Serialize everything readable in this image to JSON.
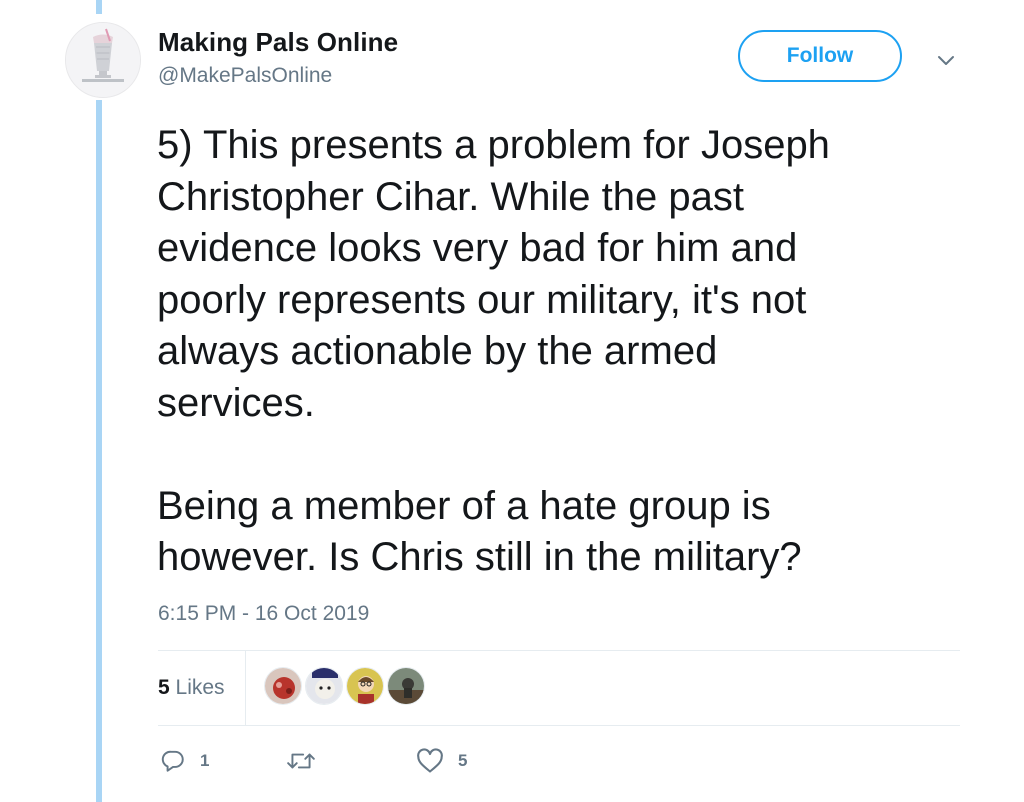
{
  "author": {
    "name": "Making Pals Online",
    "handle": "@MakePalsOnline"
  },
  "follow_label": "Follow",
  "tweet": {
    "text": "5) This presents a problem for Joseph\nChristopher Cihar. While the past\nevidence looks very bad for him and\npoorly represents our military, it's not\nalways actionable by the armed\nservices.\n\nBeing a member of a hate group is\nhowever. Is Chris still in the military?",
    "timestamp": "6:15 PM - 16 Oct 2019"
  },
  "stats": {
    "likes_count": "5",
    "likes_word": "Likes"
  },
  "actions": {
    "reply_count": "1",
    "retweet_count": "",
    "like_count": "5"
  },
  "icons": {
    "reply": "reply-icon",
    "retweet": "retweet-icon",
    "like": "heart-icon",
    "menu": "chevron-down-icon"
  },
  "colors": {
    "accent": "#1da1f2",
    "thread_line": "#a9d5f5",
    "muted_text": "#657786"
  }
}
